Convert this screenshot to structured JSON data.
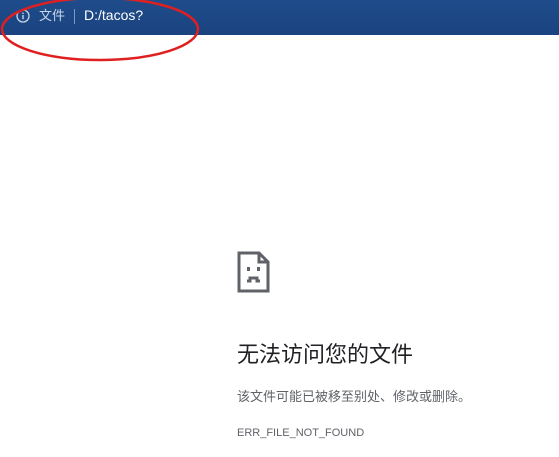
{
  "address_bar": {
    "scheme_label": "文件",
    "url": "D:/tacos?",
    "info_icon": "info-circle-icon",
    "background_color": "#1a4380"
  },
  "annotation": {
    "shape": "ellipse",
    "color": "#e02020"
  },
  "error": {
    "icon": "sad-file-icon",
    "title": "无法访问您的文件",
    "description": "该文件可能已被移至别处、修改或删除。",
    "code": "ERR_FILE_NOT_FOUND"
  }
}
